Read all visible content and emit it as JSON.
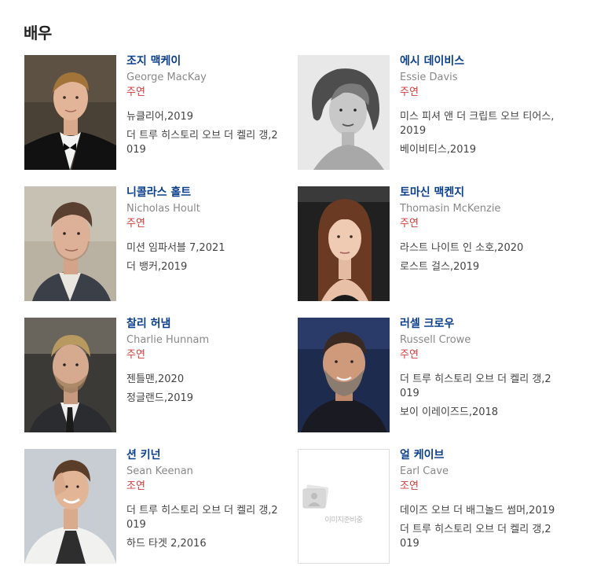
{
  "section": {
    "title": "배우"
  },
  "actors": [
    {
      "name_ko": "조지 맥케이",
      "name_en": "George MacKay",
      "role": "주연",
      "works": [
        "뉴클리어,2019",
        "더 트루 히스토리 오브 더 켈리 갱,2019"
      ]
    },
    {
      "name_ko": "에시 데이비스",
      "name_en": "Essie Davis",
      "role": "주연",
      "works": [
        "미스 피셔 앤 더 크립트 오브 티어스,2019",
        "베이비티스,2019"
      ]
    },
    {
      "name_ko": "니콜라스 홀트",
      "name_en": "Nicholas Hoult",
      "role": "주연",
      "works": [
        "미션 임파서블 7,2021",
        "더 뱅커,2019"
      ]
    },
    {
      "name_ko": "토마신 맥켄지",
      "name_en": "Thomasin McKenzie",
      "role": "주연",
      "works": [
        "라스트 나이트 인 소호,2020",
        "로스트 걸스,2019"
      ]
    },
    {
      "name_ko": "찰리 허냄",
      "name_en": "Charlie Hunnam",
      "role": "주연",
      "works": [
        "젠틀맨,2020",
        "정글랜드,2019"
      ]
    },
    {
      "name_ko": "러셀 크로우",
      "name_en": "Russell Crowe",
      "role": "주연",
      "works": [
        "더 트루 히스토리 오브 더 켈리 갱,2019",
        "보이 이레이즈드,2018"
      ]
    },
    {
      "name_ko": "션 키넌",
      "name_en": "Sean Keenan",
      "role": "조연",
      "works": [
        "더 트루 히스토리 오브 더 켈리 갱,2019",
        "하드 타겟 2,2016"
      ]
    },
    {
      "name_ko": "얼 케이브",
      "name_en": "Earl Cave",
      "role": "조연",
      "works": [
        "데이즈 오브 더 배그놀드 썸머,2019",
        "더 트루 히스토리 오브 더 켈리 갱,2019"
      ],
      "no_image_caption": "이미지준비중"
    }
  ]
}
